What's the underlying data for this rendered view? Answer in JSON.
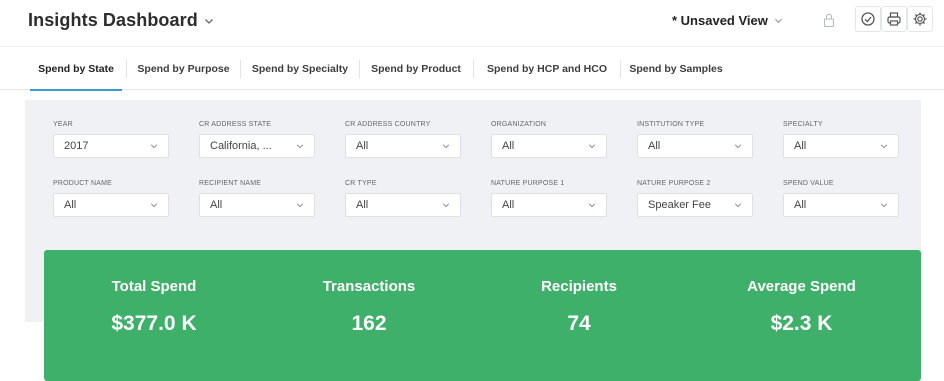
{
  "header": {
    "title": "Insights Dashboard",
    "view_label": "* Unsaved View",
    "icons": [
      "chevron-down-icon",
      "lock-icon",
      "clock-icon",
      "print-icon",
      "gear-icon"
    ]
  },
  "tabs": [
    {
      "label": "Spend by State",
      "active": true
    },
    {
      "label": "Spend by Purpose",
      "active": false
    },
    {
      "label": "Spend by Specialty",
      "active": false
    },
    {
      "label": "Spend by Product",
      "active": false
    },
    {
      "label": "Spend by HCP and HCO",
      "active": false
    },
    {
      "label": "Spend by Samples",
      "active": false
    }
  ],
  "filters": [
    {
      "label": "YEAR",
      "value": "2017"
    },
    {
      "label": "CR ADDRESS STATE",
      "value": "California, ..."
    },
    {
      "label": "CR ADDRESS COUNTRY",
      "value": "All"
    },
    {
      "label": "ORGANIZATION",
      "value": "All"
    },
    {
      "label": "INSTITUTION TYPE",
      "value": "All"
    },
    {
      "label": "SPECIALTY",
      "value": "All"
    },
    {
      "label": "PRODUCT NAME",
      "value": "All"
    },
    {
      "label": "RECIPIENT NAME",
      "value": "All"
    },
    {
      "label": "CR TYPE",
      "value": "All"
    },
    {
      "label": "NATURE PURPOSE 1",
      "value": "All"
    },
    {
      "label": "NATURE PURPOSE 2",
      "value": "Speaker Fee"
    },
    {
      "label": "SPEND VALUE",
      "value": "All"
    }
  ],
  "kpis": [
    {
      "label": "Total Spend",
      "value": "$377.0 K"
    },
    {
      "label": "Transactions",
      "value": "162"
    },
    {
      "label": "Recipients",
      "value": "74"
    },
    {
      "label": "Average Spend",
      "value": "$2.3 K"
    }
  ],
  "colors": {
    "kpi_background": "#3eb06a",
    "tab_active_underline": "#3a9bd5",
    "panel_background": "#eff1f4"
  }
}
